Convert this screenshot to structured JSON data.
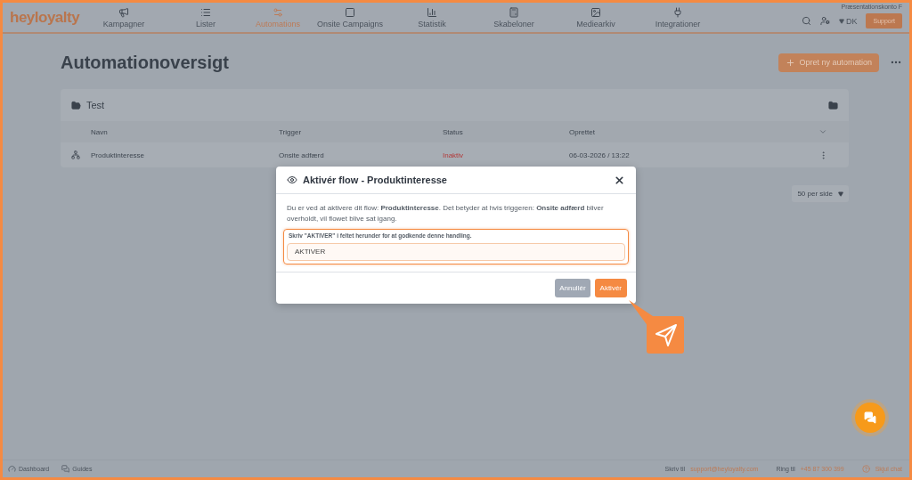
{
  "brand": "heyloyalty",
  "nav": [
    {
      "label": "Kampagner",
      "selected": false
    },
    {
      "label": "Lister",
      "selected": false
    },
    {
      "label": "Automations",
      "selected": true
    },
    {
      "label": "Onsite Campaigns",
      "selected": false
    },
    {
      "label": "Statistik",
      "selected": false
    },
    {
      "label": "Skabeloner",
      "selected": false
    },
    {
      "label": "Mediearkiv",
      "selected": false
    },
    {
      "label": "Integrationer",
      "selected": false
    }
  ],
  "account": "Præsentationskonto F",
  "language": "DK",
  "support": "Support",
  "page_title": "Automationoversigt",
  "create_button": "Opret ny automation",
  "folder": {
    "name": "Test",
    "columns": [
      "Navn",
      "Trigger",
      "Status",
      "Oprettet"
    ],
    "rows": [
      {
        "name": "Produktinteresse",
        "trigger": "Onsite adfærd",
        "status": "Inaktiv",
        "active": false,
        "created": "06-03-2026 / 13:22"
      }
    ]
  },
  "per_page": "50 per side",
  "modal": {
    "title": "Aktivér flow - Produktinteresse",
    "body": "Du er ved at aktivere dit flow: **Produktinteresse**. Det betyder at hvis triggeren: **Onsite adfærd** bliver overholdt, vil flowet blive sat igang.",
    "confirm_label": "Skriv \"AKTIVER\" i feltet herunder for at godkende denne handling.",
    "input_value": "AKTIVER",
    "focused": true,
    "cancel": "Annullér",
    "confirm": "Aktivér"
  },
  "footer": {
    "dashboard": "Dashboard",
    "guides": "Guides",
    "write_label": "Skriv til",
    "email": "support@heyloyalty.com",
    "call_label": "Ring til",
    "phone": "+45 87 300 399",
    "hide_chat": "Skjul chat"
  }
}
